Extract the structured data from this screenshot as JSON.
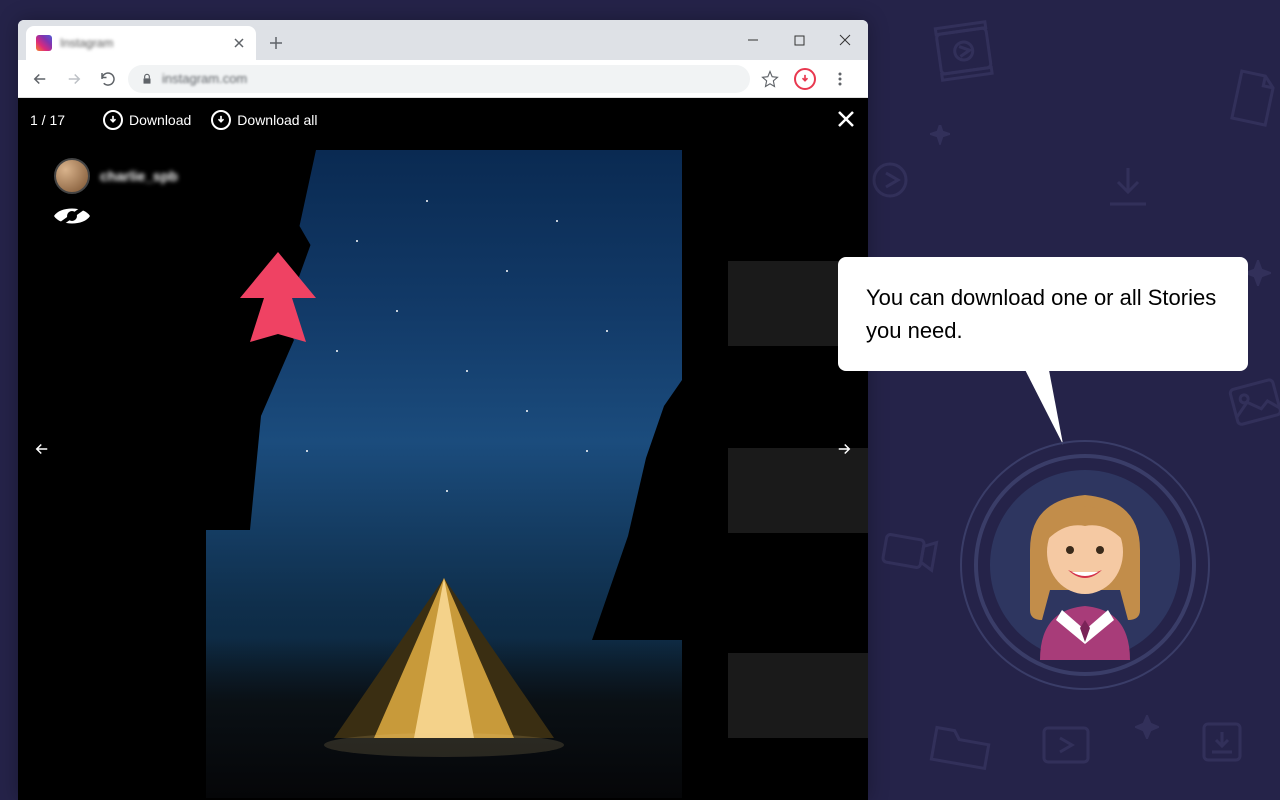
{
  "browser": {
    "tab_title": "Instagram",
    "url": "instagram.com"
  },
  "story": {
    "counter": "1 / 17",
    "download_label": "Download",
    "download_all_label": "Download all",
    "username": "charlie_spb"
  },
  "speech": {
    "text": "You can download one or all Stories you need."
  }
}
